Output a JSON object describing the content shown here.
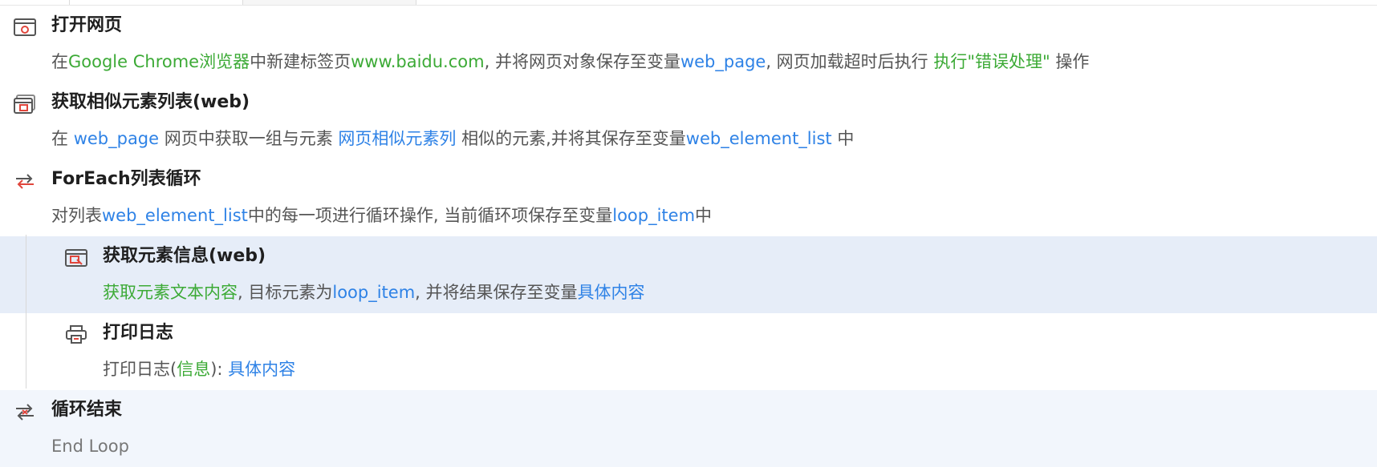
{
  "colors": {
    "green": "#3caa36",
    "blue": "#2e82e6",
    "selected_bg": "#e6edf8"
  },
  "steps": [
    {
      "title": "打开网页",
      "icon": "browser-window-icon",
      "desc": {
        "p1": "在",
        "browser": "Google Chrome浏览器",
        "p2": "中新建标签页",
        "url": "www.baidu.com",
        "p3": ", 并将网页对象保存至变量",
        "var": "web_page",
        "p4": ", 网页加载超时后执行 ",
        "action": "执行\"错误处理\"",
        "p5": " 操作"
      }
    },
    {
      "title": "获取相似元素列表(web)",
      "icon": "element-list-icon",
      "desc": {
        "p1": "在 ",
        "page": "web_page",
        "p2": " 网页中获取一组与元素 ",
        "element": "网页相似元素列",
        "p3": " 相似的元素,并将其保存至变量",
        "var": "web_element_list",
        "p4": " 中"
      }
    },
    {
      "title": "ForEach列表循环",
      "icon": "loop-icon",
      "desc": {
        "p1": "对列表",
        "list": "web_element_list",
        "p2": "中的每一项进行循环操作, 当前循环项保存至变量",
        "var": "loop_item",
        "p3": "中"
      }
    },
    {
      "title": "获取元素信息(web)",
      "icon": "element-info-icon",
      "desc": {
        "action": "获取元素文本内容",
        "p1": ", 目标元素为",
        "target": "loop_item",
        "p2": ", 并将结果保存至变量",
        "var": "具体内容"
      }
    },
    {
      "title": "打印日志",
      "icon": "printer-icon",
      "desc": {
        "p1": "打印日志(",
        "level": "信息",
        "p2": "): ",
        "var": "具体内容"
      }
    },
    {
      "title": "循环结束",
      "icon": "loop-end-icon",
      "desc": {
        "text": "End Loop"
      }
    }
  ]
}
